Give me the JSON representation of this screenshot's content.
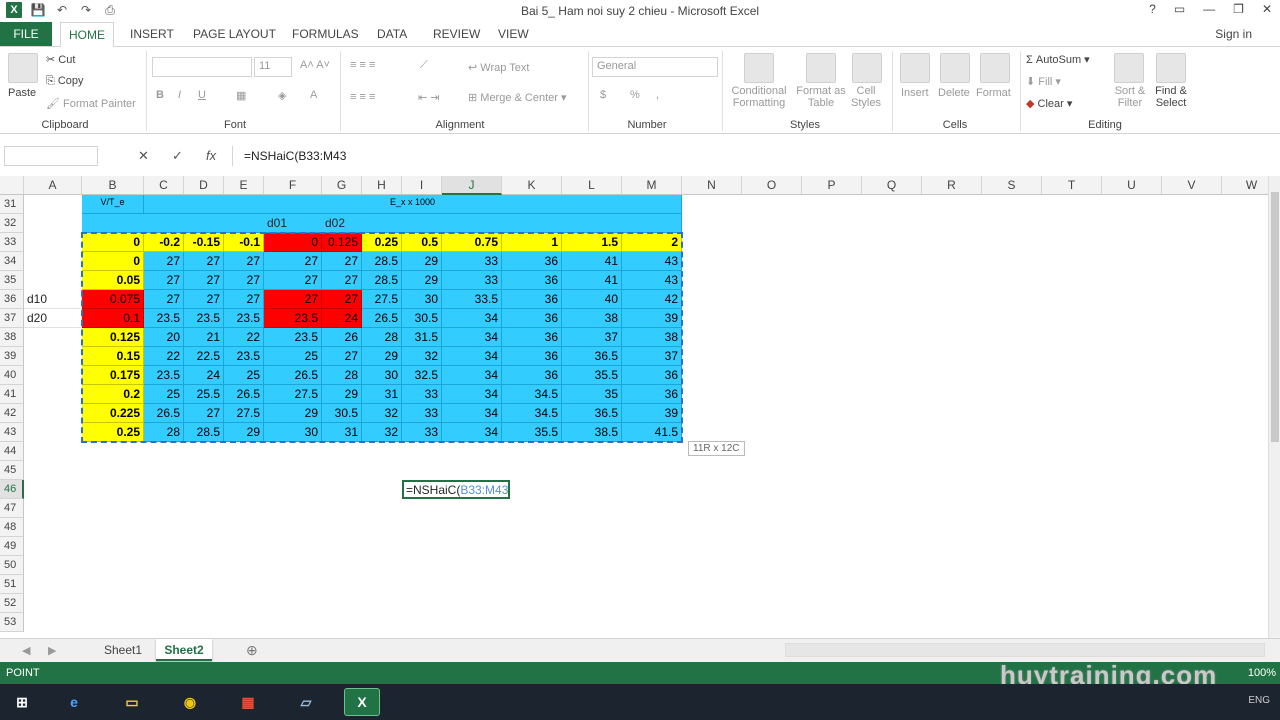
{
  "window": {
    "title": "Bai 5_ Ham noi suy 2 chieu - Microsoft Excel",
    "controls": [
      "?",
      "▭",
      "—",
      "❐",
      "✕"
    ]
  },
  "qat": {
    "icons": [
      "excel-logo",
      "save-icon",
      "undo-icon",
      "redo-icon",
      "print-icon"
    ]
  },
  "menu": {
    "file": "FILE",
    "tabs": [
      "HOME",
      "INSERT",
      "PAGE LAYOUT",
      "FORMULAS",
      "DATA",
      "REVIEW",
      "VIEW"
    ],
    "signin": "Sign in"
  },
  "ribbon": {
    "clipboard": {
      "paste": "Paste",
      "cut": "Cut",
      "copy": "Copy",
      "format_painter": "Format Painter",
      "label": "Clipboard"
    },
    "font": {
      "size": "11",
      "bold": "B",
      "italic": "I",
      "underline": "U",
      "label": "Font"
    },
    "alignment": {
      "wrap": "Wrap Text",
      "merge": "Merge & Center",
      "label": "Alignment"
    },
    "number": {
      "format": "General",
      "currency": "$",
      "percent": "%",
      "comma": ",",
      "label": "Number"
    },
    "styles": {
      "cond1": "Conditional",
      "cond2": "Formatting",
      "fmt1": "Format as",
      "fmt2": "Table",
      "cell1": "Cell",
      "cell2": "Styles",
      "label": "Styles"
    },
    "cells": {
      "insert": "Insert",
      "delete": "Delete",
      "format": "Format",
      "label": "Cells"
    },
    "editing": {
      "autosum": "AutoSum",
      "fill": "Fill",
      "clear": "Clear",
      "sort1": "Sort &",
      "sort2": "Filter",
      "find1": "Find &",
      "find2": "Select",
      "label": "Editing"
    }
  },
  "formula_bar": {
    "cancel": "✕",
    "enter": "✓",
    "fx": "fx",
    "formula": "=NSHaiC(B33:M43"
  },
  "columns": [
    "A",
    "B",
    "C",
    "D",
    "E",
    "F",
    "G",
    "H",
    "I",
    "J",
    "K",
    "L",
    "M",
    "N",
    "O",
    "P",
    "Q",
    "R",
    "S",
    "T",
    "U",
    "V",
    "W"
  ],
  "selected_column": "J",
  "rows": [
    "31",
    "32",
    "33",
    "34",
    "35",
    "36",
    "37",
    "38",
    "39",
    "40",
    "41",
    "42",
    "43",
    "44",
    "45",
    "46",
    "47",
    "48",
    "49",
    "50",
    "51",
    "52",
    "53"
  ],
  "selected_row": "46",
  "top_headers": {
    "r31_left": "V/T_e",
    "r31_center": "E_x x 1000",
    "d01": "d01",
    "d02": "d02"
  },
  "side_labels": {
    "d10": "d10",
    "d20": "d20"
  },
  "table": [
    [
      "0",
      "-0.2",
      "-0.15",
      "-0.1",
      "0",
      "0.125",
      "0.25",
      "0.5",
      "0.75",
      "1",
      "1.5",
      "2"
    ],
    [
      "0",
      "27",
      "27",
      "27",
      "27",
      "27",
      "28.5",
      "29",
      "33",
      "36",
      "41",
      "43"
    ],
    [
      "0.05",
      "27",
      "27",
      "27",
      "27",
      "27",
      "28.5",
      "29",
      "33",
      "36",
      "41",
      "43"
    ],
    [
      "0.075",
      "27",
      "27",
      "27",
      "27",
      "27",
      "27.5",
      "30",
      "33.5",
      "36",
      "40",
      "42"
    ],
    [
      "0.1",
      "23.5",
      "23.5",
      "23.5",
      "23.5",
      "24",
      "26.5",
      "30.5",
      "34",
      "36",
      "38",
      "39"
    ],
    [
      "0.125",
      "20",
      "21",
      "22",
      "23.5",
      "26",
      "28",
      "31.5",
      "34",
      "36",
      "37",
      "38"
    ],
    [
      "0.15",
      "22",
      "22.5",
      "23.5",
      "25",
      "27",
      "29",
      "32",
      "34",
      "36",
      "36.5",
      "37"
    ],
    [
      "0.175",
      "23.5",
      "24",
      "25",
      "26.5",
      "28",
      "30",
      "32.5",
      "34",
      "36",
      "35.5",
      "36"
    ],
    [
      "0.2",
      "25",
      "25.5",
      "26.5",
      "27.5",
      "29",
      "31",
      "33",
      "34",
      "34.5",
      "35",
      "36"
    ],
    [
      "0.225",
      "26.5",
      "27",
      "27.5",
      "29",
      "30.5",
      "32",
      "33",
      "34",
      "34.5",
      "36.5",
      "39"
    ],
    [
      "0.25",
      "28",
      "28.5",
      "29",
      "30",
      "31",
      "32",
      "33",
      "34",
      "35.5",
      "38.5",
      "41.5"
    ]
  ],
  "edit_cell": {
    "prefix": "=NSHaiC(",
    "ref": "B33:M43"
  },
  "tooltip": "11R x 12C",
  "sheets": [
    "Sheet1",
    "Sheet2"
  ],
  "active_sheet": "Sheet2",
  "status": {
    "mode": "POINT",
    "zoom": "100%"
  },
  "watermark": "huytraining.com",
  "tray": {
    "lang": "ENG"
  }
}
